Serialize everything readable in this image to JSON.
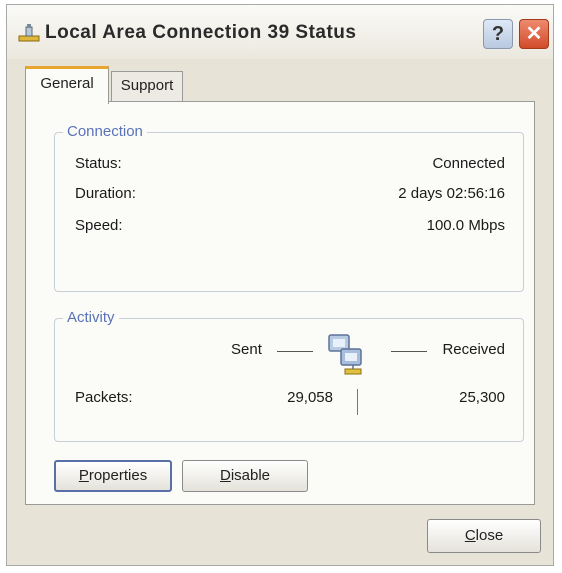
{
  "window": {
    "title": "Local Area Connection 39 Status",
    "help_symbol": "?",
    "close_symbol": "✕"
  },
  "tabs": [
    {
      "label": "General",
      "active": true
    },
    {
      "label": "Support",
      "active": false
    }
  ],
  "connection": {
    "legend": "Connection",
    "rows": [
      {
        "label": "Status:",
        "value": "Connected"
      },
      {
        "label": "Duration:",
        "value": "2 days 02:56:16"
      },
      {
        "label": "Speed:",
        "value": "100.0 Mbps"
      }
    ]
  },
  "activity": {
    "legend": "Activity",
    "sent_label": "Sent",
    "received_label": "Received",
    "packets_label": "Packets:",
    "packets_sent": "29,058",
    "packets_received": "25,300"
  },
  "buttons": {
    "properties_first": "P",
    "properties_rest": "roperties",
    "disable_first": "D",
    "disable_rest": "isable",
    "close_first": "C",
    "close_rest": "lose"
  },
  "icons": {
    "title": "network-connection-icon",
    "activity": "network-activity-icon"
  },
  "colors": {
    "tab_accent": "#e8a530",
    "group_legend": "#5a73b8",
    "close_button": "#d14b2a"
  }
}
